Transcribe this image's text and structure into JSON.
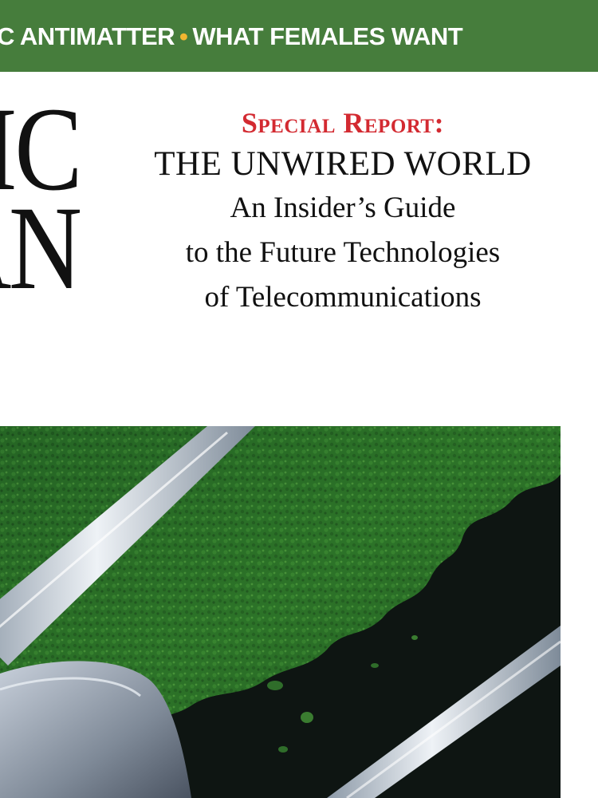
{
  "banner": {
    "left_text": "C ANTIMATTER",
    "separator": "•",
    "right_text": "WHAT FEMALES WANT"
  },
  "masthead": {
    "line1": "IC",
    "line2": "AN"
  },
  "special_report": {
    "kicker": "Special Report:",
    "title": "THE UNWIRED WORLD",
    "subtitle_line1": "An Insider’s Guide",
    "subtitle_line2": "to the Future Technologies",
    "subtitle_line3": "of Telecommunications"
  },
  "colors": {
    "banner_green": "#467d3c",
    "separator_yellow": "#f2b630",
    "kicker_red": "#d32a31",
    "text_black": "#111111"
  }
}
